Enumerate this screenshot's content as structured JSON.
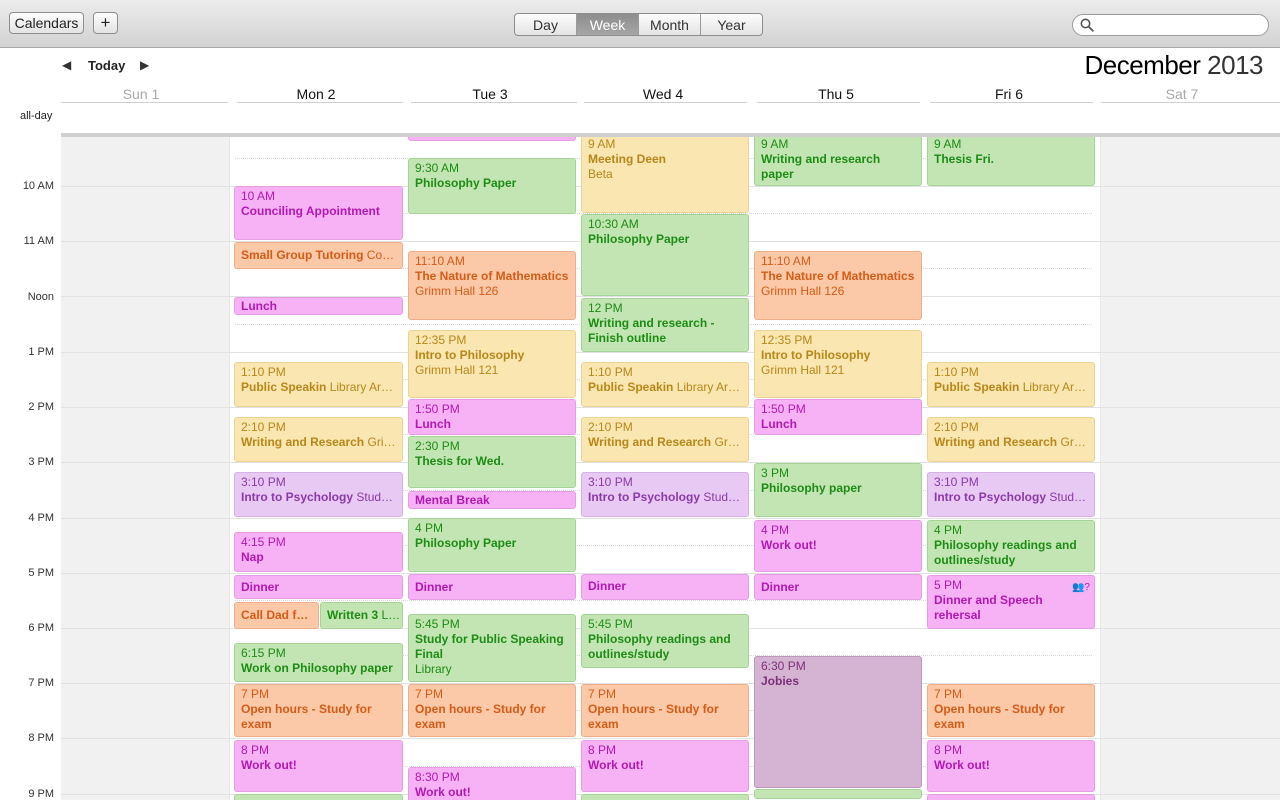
{
  "toolbar": {
    "calendars_label": "Calendars",
    "add_label": "+",
    "views": [
      {
        "label": "Day",
        "active": false
      },
      {
        "label": "Week",
        "active": true
      },
      {
        "label": "Month",
        "active": false
      },
      {
        "label": "Year",
        "active": false
      }
    ],
    "search_placeholder": ""
  },
  "nav": {
    "prev": "◀",
    "today_label": "Today",
    "next": "▶",
    "month": "December",
    "year": "2013"
  },
  "days": [
    {
      "label": "Sun 1",
      "weekend": true
    },
    {
      "label": "Mon 2",
      "weekend": false
    },
    {
      "label": "Tue 3",
      "weekend": false
    },
    {
      "label": "Wed 4",
      "weekend": false
    },
    {
      "label": "Thu 5",
      "weekend": false
    },
    {
      "label": "Fri 6",
      "weekend": false
    },
    {
      "label": "Sat 7",
      "weekend": true
    }
  ],
  "allday_label": "all-day",
  "hours": [
    "10 AM",
    "11 AM",
    "Noon",
    "1 PM",
    "2 PM",
    "3 PM",
    "4 PM",
    "5 PM",
    "6 PM",
    "7 PM",
    "8 PM",
    "9 PM"
  ],
  "colors": {
    "green": "#c3e5b4",
    "pink": "#f7b2f5",
    "orange": "#fbc8a8",
    "yellow": "#f9e6b0",
    "purple": "#e7c9f3",
    "mauve": "#d5b3d3"
  },
  "events": {
    "mon": [
      {
        "time": "10 AM",
        "name": "Counciling Appointment",
        "loc": "",
        "color": "pink"
      },
      {
        "time": "",
        "name": "Small Group Tutoring",
        "loc": "Co…",
        "color": "orange"
      },
      {
        "time": "",
        "name": "Lunch",
        "loc": "",
        "color": "pink"
      },
      {
        "time": "1:10 PM",
        "name": "Public Speakin",
        "loc": "Library Ar…",
        "color": "yellow"
      },
      {
        "time": "2:10 PM",
        "name": "Writing and Research",
        "loc": "Gri…",
        "color": "yellow"
      },
      {
        "time": "3:10 PM",
        "name": "Intro to Psychology",
        "loc": "Stud…",
        "color": "purple"
      },
      {
        "time": "4:15 PM",
        "name": "Nap",
        "loc": "",
        "color": "pink"
      },
      {
        "time": "",
        "name": "Dinner",
        "loc": "",
        "color": "pink"
      },
      {
        "time": "",
        "name": "Call Dad f…",
        "loc": "",
        "color": "orange"
      },
      {
        "time": "",
        "name": "Written 3",
        "loc": "L…",
        "color": "green"
      },
      {
        "time": "6:15 PM",
        "name": "Work on Philosophy paper",
        "loc": "",
        "color": "green"
      },
      {
        "time": "7 PM",
        "name": "Open hours - Study for exam",
        "loc": "",
        "color": "orange"
      },
      {
        "time": "8 PM",
        "name": "Work out!",
        "loc": "",
        "color": "pink"
      }
    ],
    "tue": [
      {
        "time": "9:30 AM",
        "name": "Philosophy Paper",
        "loc": "",
        "color": "green"
      },
      {
        "time": "11:10 AM",
        "name": "The Nature of Mathematics",
        "loc": "Grimm Hall 126",
        "color": "orange"
      },
      {
        "time": "12:35 PM",
        "name": "Intro to Philosophy",
        "loc": "Grimm Hall 121",
        "color": "yellow"
      },
      {
        "time": "1:50 PM",
        "name": "Lunch",
        "loc": "",
        "color": "pink"
      },
      {
        "time": "2:30 PM",
        "name": "Thesis for Wed.",
        "loc": "",
        "color": "green"
      },
      {
        "time": "",
        "name": "Mental Break",
        "loc": "",
        "color": "pink"
      },
      {
        "time": "4 PM",
        "name": "Philosophy Paper",
        "loc": "",
        "color": "green"
      },
      {
        "time": "",
        "name": "Dinner",
        "loc": "",
        "color": "pink"
      },
      {
        "time": "5:45 PM",
        "name": "Study for Public Speaking Final",
        "loc": "Library",
        "color": "green"
      },
      {
        "time": "7 PM",
        "name": "Open hours - Study for exam",
        "loc": "",
        "color": "orange"
      },
      {
        "time": "8:30 PM",
        "name": "Work out!",
        "loc": "",
        "color": "pink"
      }
    ],
    "wed": [
      {
        "time": "9 AM",
        "name": "Meeting Deen",
        "loc": "Beta",
        "color": "yellow"
      },
      {
        "time": "10:30 AM",
        "name": "Philosophy Paper",
        "loc": "",
        "color": "green"
      },
      {
        "time": "12 PM",
        "name": "Writing and research - Finish outline",
        "loc": "",
        "color": "green"
      },
      {
        "time": "1:10 PM",
        "name": "Public Speakin",
        "loc": "Library Ar…",
        "color": "yellow"
      },
      {
        "time": "2:10 PM",
        "name": "Writing and Research",
        "loc": "Gr…",
        "color": "yellow"
      },
      {
        "time": "3:10 PM",
        "name": "Intro to Psychology",
        "loc": "Stud…",
        "color": "purple"
      },
      {
        "time": "",
        "name": "Dinner",
        "loc": "",
        "color": "pink"
      },
      {
        "time": "5:45 PM",
        "name": "Philosophy readings and outlines/study",
        "loc": "",
        "color": "green"
      },
      {
        "time": "7 PM",
        "name": "Open hours - Study for exam",
        "loc": "",
        "color": "orange"
      },
      {
        "time": "8 PM",
        "name": "Work out!",
        "loc": "",
        "color": "pink"
      }
    ],
    "thu": [
      {
        "time": "9 AM",
        "name": "Writing and research paper",
        "loc": "",
        "color": "green"
      },
      {
        "time": "11:10 AM",
        "name": "The Nature of Mathematics",
        "loc": "Grimm Hall 126",
        "color": "orange"
      },
      {
        "time": "12:35 PM",
        "name": "Intro to Philosophy",
        "loc": "Grimm Hall 121",
        "color": "yellow"
      },
      {
        "time": "1:50 PM",
        "name": "Lunch",
        "loc": "",
        "color": "pink"
      },
      {
        "time": "3 PM",
        "name": "Philosophy paper",
        "loc": "",
        "color": "green"
      },
      {
        "time": "4 PM",
        "name": "Work out!",
        "loc": "",
        "color": "pink"
      },
      {
        "time": "",
        "name": "Dinner",
        "loc": "",
        "color": "pink"
      },
      {
        "time": "6:30 PM",
        "name": "Jobies",
        "loc": "",
        "color": "mauve"
      }
    ],
    "fri": [
      {
        "time": "9 AM",
        "name": "Thesis Fri.",
        "loc": "",
        "color": "green"
      },
      {
        "time": "1:10 PM",
        "name": "Public Speakin",
        "loc": "Library Ar…",
        "color": "yellow"
      },
      {
        "time": "2:10 PM",
        "name": "Writing and Research",
        "loc": "Gr…",
        "color": "yellow"
      },
      {
        "time": "3:10 PM",
        "name": "Intro to Psychology",
        "loc": "Stud…",
        "color": "purple"
      },
      {
        "time": "4 PM",
        "name": "Philosophy readings and outlines/study",
        "loc": "",
        "color": "green"
      },
      {
        "time": "5 PM",
        "name": "Dinner and Speech rehersal",
        "loc": "",
        "color": "pink",
        "icon": "people-icon"
      },
      {
        "time": "7 PM",
        "name": "Open hours - Study for exam",
        "loc": "",
        "color": "orange"
      },
      {
        "time": "8 PM",
        "name": "Work out!",
        "loc": "",
        "color": "pink"
      }
    ]
  }
}
